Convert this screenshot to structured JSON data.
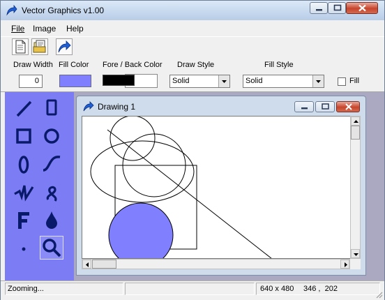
{
  "window": {
    "title": "Vector Graphics v1.00"
  },
  "menu": {
    "file": "File",
    "image": "Image",
    "help": "Help"
  },
  "toolbar": {
    "buttons": [
      "new-document-icon",
      "open-image-icon",
      "redo-icon"
    ]
  },
  "properties": {
    "draw_width_label": "Draw Width",
    "draw_width_value": "0",
    "fill_color_label": "Fill Color",
    "fill_color": "#8080ff",
    "fore_back_label": "Fore / Back Color",
    "fore_color": "#000000",
    "back_color": "#ffffff",
    "draw_style_label": "Draw Style",
    "draw_style_value": "Solid",
    "fill_style_label": "Fill Style",
    "fill_style_value": "Solid",
    "fill_checkbox_label": "Fill",
    "fill_checked": false
  },
  "tools": [
    "line-tool-icon",
    "rectangle-rounded-tool-icon",
    "square-tool-icon",
    "circle-tool-icon",
    "ellipse-tool-icon",
    "curve-tool-icon",
    "polyline-tool-icon",
    "freehand-tool-icon",
    "text-tool-icon",
    "fill-bucket-tool-icon",
    "point-tool-icon",
    "zoom-tool-icon"
  ],
  "active_tool": "zoom-tool-icon",
  "drawing": {
    "title": "Drawing  1"
  },
  "status": {
    "message": "Zooming...",
    "canvas_size": "640 x 480",
    "cursor_pos": "346 ,  202"
  },
  "colors": {
    "palette": "#7c7cf4",
    "mdi_bg": "#aba9c2",
    "accent": "#1a56c8"
  }
}
